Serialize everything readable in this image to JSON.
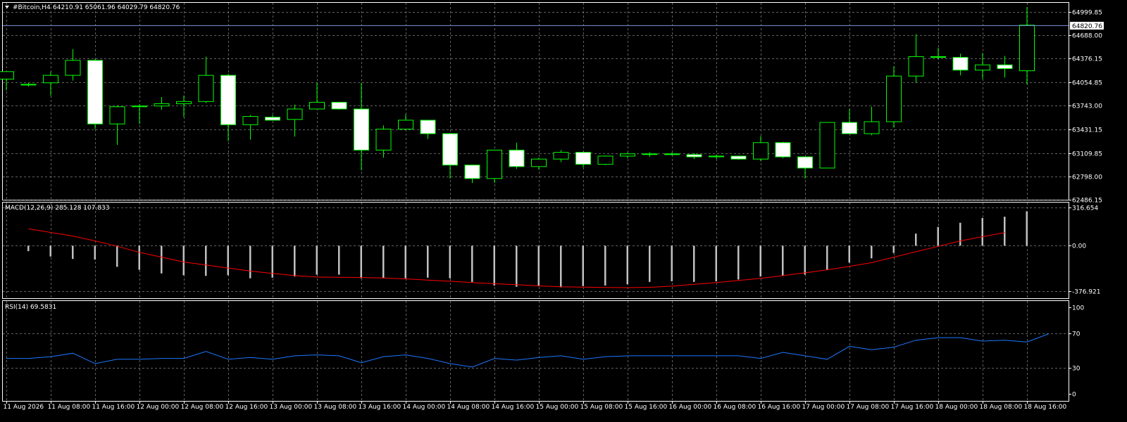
{
  "colors": {
    "background": "#000000",
    "grid": "#b0b0b0",
    "frame": "#ffffff",
    "candle_outline": "#00ff00",
    "bull_body": "#000000",
    "bear_body": "#ffffff",
    "price_line": "#6f8ccf",
    "macd_hist": "#c0c0c0",
    "macd_signal": "#ff0000",
    "rsi_line": "#1e78ff"
  },
  "header": {
    "symbol": "#Bitcoin,H4",
    "ohlc": "64210.91 65061.96 64029.79 64820.76"
  },
  "chart_data": [
    {
      "type": "candlestick",
      "title": "#Bitcoin,H4",
      "ylim": [
        62486.15,
        65120
      ],
      "y_ticks": [
        "64999.85",
        "64688.00",
        "64376.15",
        "64054.85",
        "63743.00",
        "63431.15",
        "63109.85",
        "62798.00",
        "62486.15"
      ],
      "current_price_label": "64820.76",
      "candles": [
        {
          "o": 64100,
          "h": 64200,
          "l": 63950,
          "c": 64200
        },
        {
          "o": 64020,
          "h": 64050,
          "l": 64000,
          "c": 64030
        },
        {
          "o": 64050,
          "h": 64200,
          "l": 63880,
          "c": 64150
        },
        {
          "o": 64150,
          "h": 64500,
          "l": 64080,
          "c": 64350
        },
        {
          "o": 64350,
          "h": 64370,
          "l": 63430,
          "c": 63500
        },
        {
          "o": 63500,
          "h": 63750,
          "l": 63220,
          "c": 63730
        },
        {
          "o": 63730,
          "h": 63760,
          "l": 63500,
          "c": 63740
        },
        {
          "o": 63740,
          "h": 63860,
          "l": 63690,
          "c": 63770
        },
        {
          "o": 63770,
          "h": 63880,
          "l": 63590,
          "c": 63800
        },
        {
          "o": 63800,
          "h": 64400,
          "l": 63780,
          "c": 64150
        },
        {
          "o": 64150,
          "h": 64170,
          "l": 63270,
          "c": 63490
        },
        {
          "o": 63490,
          "h": 63620,
          "l": 63290,
          "c": 63600
        },
        {
          "o": 63590,
          "h": 63620,
          "l": 63560,
          "c": 63550
        },
        {
          "o": 63560,
          "h": 63760,
          "l": 63330,
          "c": 63700
        },
        {
          "o": 63700,
          "h": 64050,
          "l": 63700,
          "c": 63790
        },
        {
          "o": 63790,
          "h": 63780,
          "l": 63690,
          "c": 63700
        },
        {
          "o": 63700,
          "h": 64050,
          "l": 62880,
          "c": 63150
        },
        {
          "o": 63150,
          "h": 63480,
          "l": 63050,
          "c": 63430
        },
        {
          "o": 63430,
          "h": 63630,
          "l": 63420,
          "c": 63550
        },
        {
          "o": 63550,
          "h": 63550,
          "l": 63300,
          "c": 63370
        },
        {
          "o": 63370,
          "h": 63380,
          "l": 62770,
          "c": 62950
        },
        {
          "o": 62950,
          "h": 62950,
          "l": 62710,
          "c": 62770
        },
        {
          "o": 62770,
          "h": 63150,
          "l": 62710,
          "c": 63150
        },
        {
          "o": 63150,
          "h": 63250,
          "l": 62900,
          "c": 62930
        },
        {
          "o": 62930,
          "h": 63050,
          "l": 62890,
          "c": 63030
        },
        {
          "o": 63030,
          "h": 63150,
          "l": 62990,
          "c": 63120
        },
        {
          "o": 63120,
          "h": 63130,
          "l": 62920,
          "c": 62960
        },
        {
          "o": 62960,
          "h": 63080,
          "l": 62950,
          "c": 63070
        },
        {
          "o": 63070,
          "h": 63120,
          "l": 63040,
          "c": 63100
        },
        {
          "o": 63100,
          "h": 63120,
          "l": 63060,
          "c": 63100
        },
        {
          "o": 63100,
          "h": 63120,
          "l": 63080,
          "c": 63090
        },
        {
          "o": 63090,
          "h": 63110,
          "l": 63030,
          "c": 63060
        },
        {
          "o": 63060,
          "h": 63090,
          "l": 63030,
          "c": 63070
        },
        {
          "o": 63070,
          "h": 63050,
          "l": 63020,
          "c": 63030
        },
        {
          "o": 63030,
          "h": 63340,
          "l": 63000,
          "c": 63250
        },
        {
          "o": 63250,
          "h": 63260,
          "l": 63040,
          "c": 63060
        },
        {
          "o": 63060,
          "h": 63060,
          "l": 62770,
          "c": 62910
        },
        {
          "o": 62910,
          "h": 63520,
          "l": 62910,
          "c": 63520
        },
        {
          "o": 63520,
          "h": 63700,
          "l": 63370,
          "c": 63370
        },
        {
          "o": 63370,
          "h": 63730,
          "l": 63350,
          "c": 63530
        },
        {
          "o": 63530,
          "h": 64270,
          "l": 63450,
          "c": 64140
        },
        {
          "o": 64140,
          "h": 64700,
          "l": 64050,
          "c": 64400
        },
        {
          "o": 64400,
          "h": 64520,
          "l": 64370,
          "c": 64390
        },
        {
          "o": 64390,
          "h": 64440,
          "l": 64150,
          "c": 64220
        },
        {
          "o": 64220,
          "h": 64450,
          "l": 64100,
          "c": 64290
        },
        {
          "o": 64290,
          "h": 64410,
          "l": 64120,
          "c": 64240
        },
        {
          "o": 64210.91,
          "h": 65061.96,
          "l": 64029.79,
          "c": 64820.76
        }
      ]
    },
    {
      "type": "bar",
      "title": "MACD(12,26,9) 285.128 107.833",
      "ylim": [
        -376.921,
        316.654
      ],
      "y_ticks": [
        "316.654",
        "0.00",
        "-376.921"
      ],
      "histogram": [
        -45,
        -90,
        -110,
        -115,
        -175,
        -200,
        -230,
        -245,
        -250,
        -245,
        -270,
        -265,
        -255,
        -240,
        -240,
        -270,
        -270,
        -270,
        -265,
        -270,
        -300,
        -330,
        -340,
        -335,
        -345,
        -335,
        -330,
        -320,
        -300,
        -295,
        -300,
        -295,
        -280,
        -255,
        -250,
        -240,
        -200,
        -140,
        -105,
        -60,
        100,
        155,
        190,
        230,
        240,
        285
      ],
      "signal": [
        140,
        110,
        80,
        40,
        -5,
        -55,
        -95,
        -135,
        -160,
        -185,
        -210,
        -230,
        -248,
        -260,
        -262,
        -264,
        -268,
        -275,
        -285,
        -295,
        -305,
        -315,
        -323,
        -333,
        -340,
        -343,
        -346,
        -348,
        -345,
        -335,
        -320,
        -305,
        -288,
        -270,
        -248,
        -225,
        -200,
        -172,
        -140,
        -95,
        -50,
        -5,
        40,
        75,
        108
      ]
    },
    {
      "type": "line",
      "title": "RSI(14) 69.5831",
      "ylim": [
        0,
        100
      ],
      "y_ticks": [
        "100",
        "70",
        "30",
        "0"
      ],
      "values": [
        41,
        41,
        43,
        47,
        35,
        40,
        40,
        41,
        41,
        49,
        40,
        42,
        40,
        44,
        45,
        44,
        36,
        43,
        45,
        41,
        35,
        31,
        41,
        39,
        42,
        44,
        40,
        43,
        44,
        44,
        44,
        44,
        44,
        44,
        41,
        48,
        44,
        40,
        55,
        51,
        54,
        62,
        65,
        65,
        61,
        62,
        60,
        69.58
      ]
    }
  ],
  "time_axis": [
    "11 Aug 2026",
    "11 Aug 08:00",
    "11 Aug 16:00",
    "12 Aug 00:00",
    "12 Aug 08:00",
    "12 Aug 16:00",
    "13 Aug 00:00",
    "13 Aug 08:00",
    "13 Aug 16:00",
    "14 Aug 00:00",
    "14 Aug 08:00",
    "14 Aug 16:00",
    "15 Aug 00:00",
    "15 Aug 08:00",
    "15 Aug 16:00",
    "16 Aug 00:00",
    "16 Aug 08:00",
    "16 Aug 16:00",
    "17 Aug 00:00",
    "17 Aug 08:00",
    "17 Aug 16:00",
    "18 Aug 00:00",
    "18 Aug 08:00",
    "18 Aug 16:00"
  ]
}
